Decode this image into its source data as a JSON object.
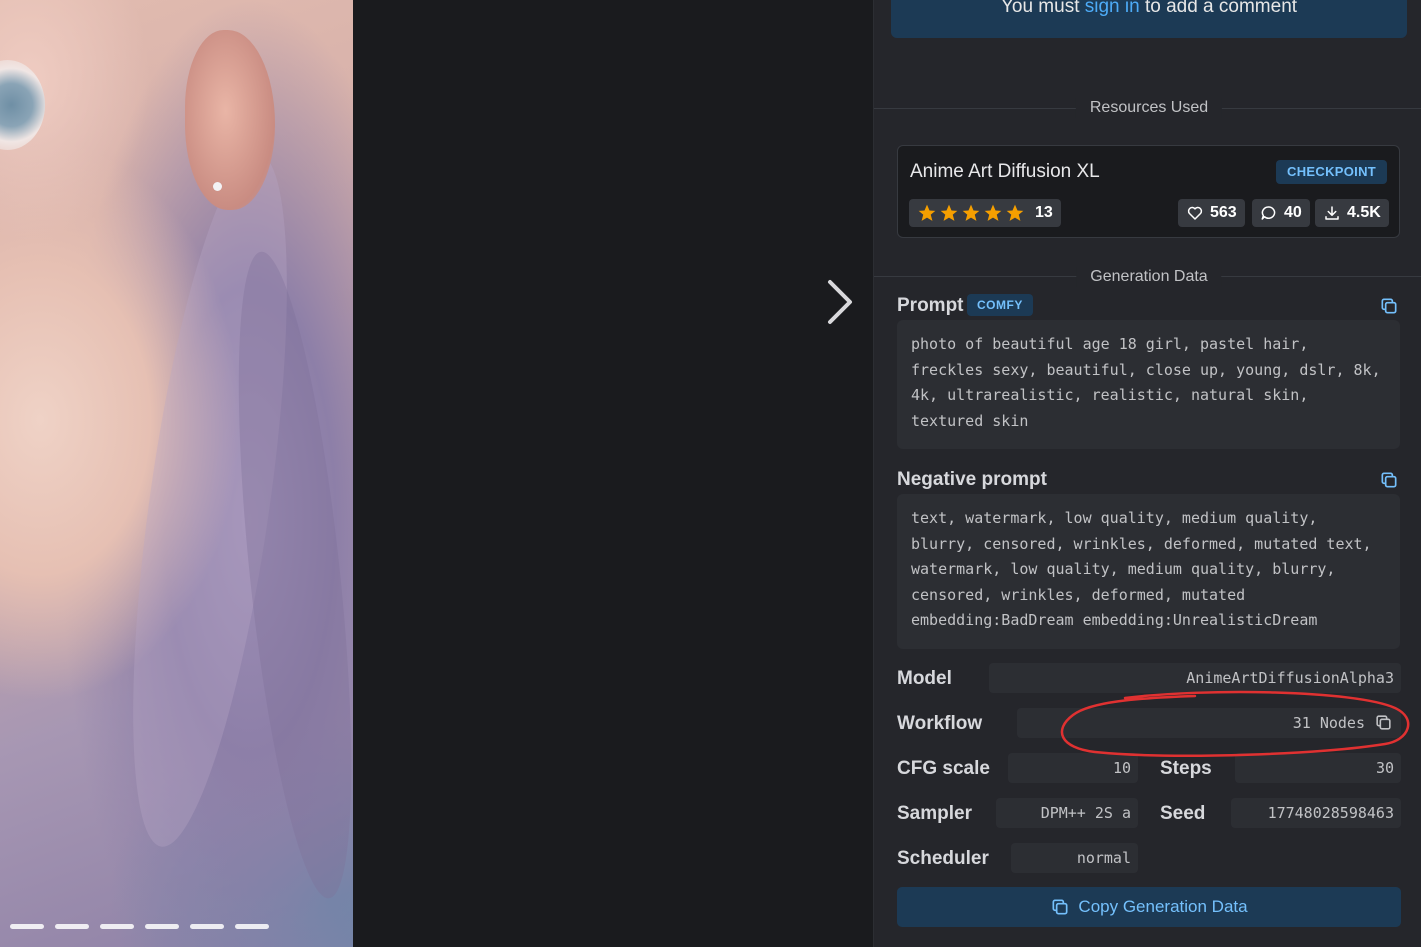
{
  "comment_notice": {
    "prefix": "You must",
    "link": "sign in",
    "suffix": "to add a comment"
  },
  "resources": {
    "heading": "Resources Used",
    "item": {
      "name": "Anime Art Diffusion XL",
      "badge": "CHECKPOINT",
      "rating_stars": 5,
      "rating_count": "13",
      "likes": "563",
      "comments": "40",
      "downloads": "4.5K"
    }
  },
  "generation": {
    "heading": "Generation Data",
    "prompt_label": "Prompt",
    "prompt_badge": "COMFY",
    "prompt": "photo of beautiful age 18 girl, pastel hair, freckles sexy, beautiful, close up, young, dslr, 8k, 4k, ultrarealistic, realistic, natural skin, textured skin",
    "negative_label": "Negative prompt",
    "negative": "text, watermark, low quality, medium quality, blurry, censored, wrinkles, deformed, mutated text, watermark, low quality, medium quality, blurry, censored, wrinkles, deformed, mutated embedding:BadDream embedding:UnrealisticDream",
    "fields": {
      "model_label": "Model",
      "model": "AnimeArtDiffusionAlpha3",
      "workflow_label": "Workflow",
      "workflow": "31 Nodes",
      "cfg_label": "CFG scale",
      "cfg": "10",
      "steps_label": "Steps",
      "steps": "30",
      "sampler_label": "Sampler",
      "sampler": "DPM++ 2S a",
      "seed_label": "Seed",
      "seed": "17748028598463",
      "scheduler_label": "Scheduler",
      "scheduler": "normal"
    },
    "copy_button": "Copy Generation Data"
  },
  "carousel": {
    "slides": 6
  },
  "colors": {
    "accent": "#74c0fc",
    "badge_bg": "#1c3a55",
    "star": "#f59f00",
    "annotation": "#e03131"
  },
  "icons": [
    "chevron-right-icon",
    "star-icon",
    "heart-icon",
    "comment-icon",
    "download-icon",
    "copy-icon"
  ]
}
